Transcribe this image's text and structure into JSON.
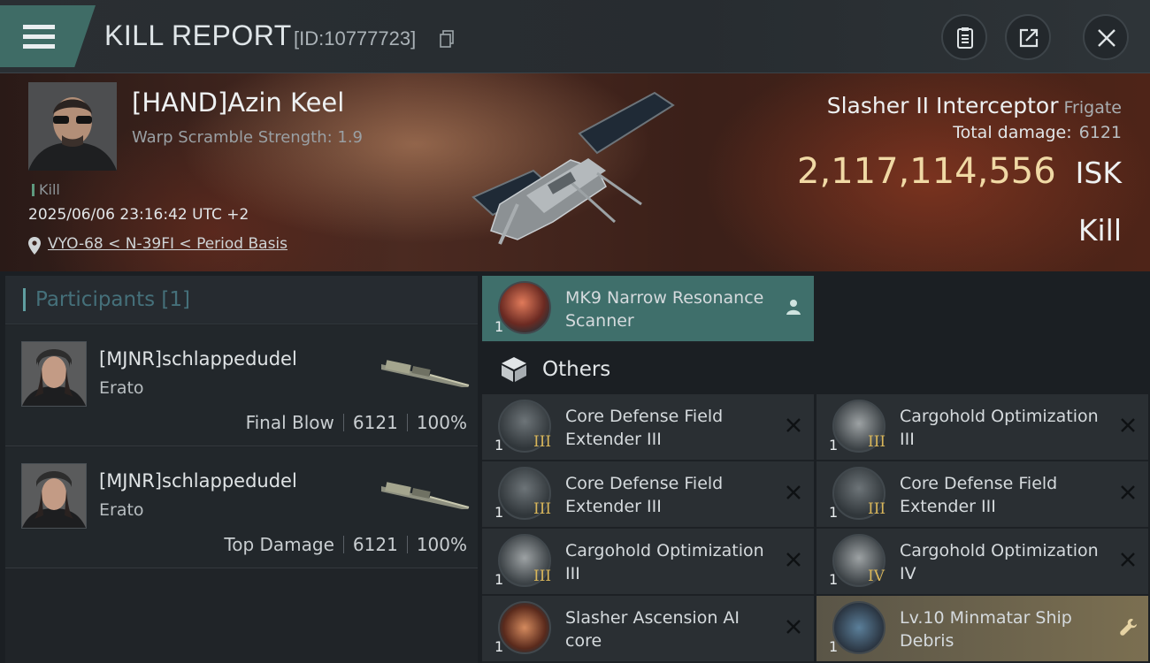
{
  "header": {
    "title": "KILL REPORT",
    "report_id": "[ID:10777723]"
  },
  "victim": {
    "pilot_name": "[HAND]Azin Keel",
    "warp_scramble": "Warp Scramble Strength: 1.9",
    "tag": "Kill",
    "datetime": "2025/06/06 23:16:42 UTC +2",
    "location": "VYO-68 < N-39FI < Period Basis",
    "ship_name": "Slasher II Interceptor",
    "ship_class": "Frigate",
    "total_damage_label": "Total damage:",
    "total_damage": "6121",
    "isk_value": "2,117,114,556",
    "isk_unit": "ISK",
    "result": "Kill"
  },
  "participants": {
    "header_label": "Participants",
    "count": "[1]",
    "rows": [
      {
        "name": "[MJNR]schlappedudel",
        "ship": "Erato",
        "role": "Final Blow",
        "damage": "6121",
        "percent": "100%"
      },
      {
        "name": "[MJNR]schlappedudel",
        "ship": "Erato",
        "role": "Top Damage",
        "damage": "6121",
        "percent": "100%"
      }
    ]
  },
  "modules": {
    "highlighted": {
      "name": "MK9 Narrow Resonance Scanner",
      "qty": "1",
      "icon": "scanner-module-icon",
      "action_icon": "person-icon"
    },
    "others_label": "Others",
    "items": [
      {
        "name": "Core Defense Field Extender III",
        "qty": "1",
        "tier": "III",
        "icon": "shield-extender-icon",
        "action_icon": "close-icon"
      },
      {
        "name": "Cargohold Optimization III",
        "qty": "1",
        "tier": "III",
        "icon": "cargohold-rig-icon",
        "action_icon": "close-icon"
      },
      {
        "name": "Core Defense Field Extender III",
        "qty": "1",
        "tier": "III",
        "icon": "shield-extender-icon",
        "action_icon": "close-icon"
      },
      {
        "name": "Core Defense Field Extender III",
        "qty": "1",
        "tier": "III",
        "icon": "shield-extender-icon",
        "action_icon": "close-icon"
      },
      {
        "name": "Cargohold Optimization III",
        "qty": "1",
        "tier": "III",
        "icon": "cargohold-rig-icon",
        "action_icon": "close-icon"
      },
      {
        "name": "Cargohold Optimization IV",
        "qty": "1",
        "tier": "IV",
        "icon": "cargohold-rig-icon",
        "action_icon": "close-icon"
      },
      {
        "name": "Slasher Ascension AI core",
        "qty": "1",
        "tier": "",
        "icon": "ai-core-icon",
        "action_icon": "close-icon"
      },
      {
        "name": "Lv.10 Minmatar Ship Debris",
        "qty": "1",
        "tier": "",
        "icon": "ship-debris-icon",
        "action_icon": "wrench-icon"
      }
    ]
  },
  "colors": {
    "accent_teal": "#3f6f6b",
    "isk_gold": "#f0d9a5",
    "tier_gold": "#d9b65a"
  }
}
